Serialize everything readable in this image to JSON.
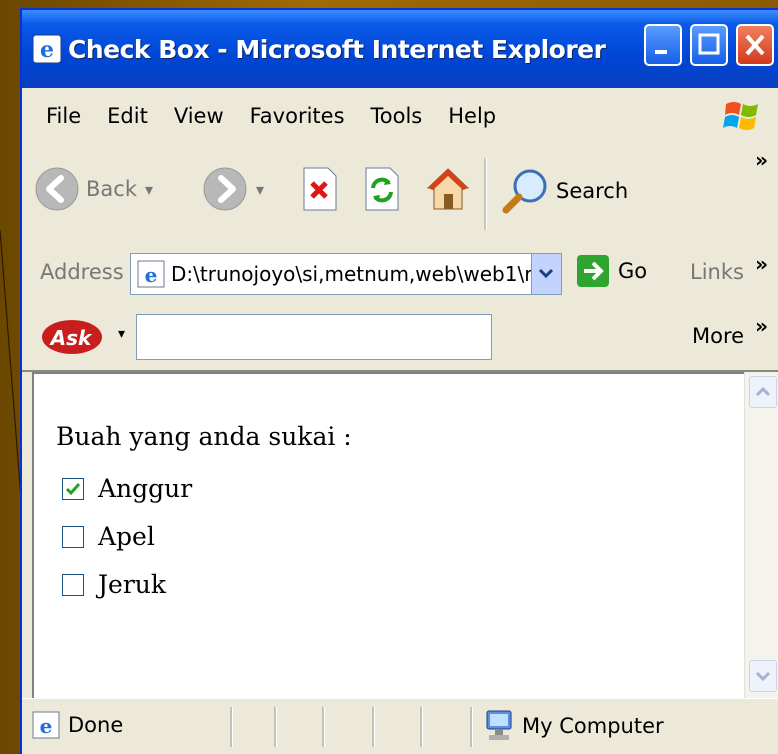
{
  "window": {
    "title": "Check Box - Microsoft Internet Explorer"
  },
  "menu": [
    "File",
    "Edit",
    "View",
    "Favorites",
    "Tools",
    "Help"
  ],
  "toolbar": {
    "back_label": "Back",
    "search_label": "Search",
    "overflow": "»"
  },
  "address": {
    "label": "Address",
    "value": "D:\\trunojoyo\\si,metnum,web\\web1\\r",
    "go_label": "Go",
    "links_label": "Links",
    "links_overflow": "»"
  },
  "askbar": {
    "logo_text": "Ask",
    "search_value": "",
    "more_label": "More",
    "more_chevron": "»"
  },
  "page": {
    "prompt": "Buah yang anda sukai :",
    "options": [
      {
        "label": "Anggur",
        "checked": true
      },
      {
        "label": "Apel",
        "checked": false
      },
      {
        "label": "Jeruk",
        "checked": false
      }
    ]
  },
  "status": {
    "text": "Done",
    "zone": "My Computer"
  },
  "colors": {
    "titlebar": "#0046d5",
    "chrome": "#ece9d8",
    "checkmark": "#21a121"
  }
}
